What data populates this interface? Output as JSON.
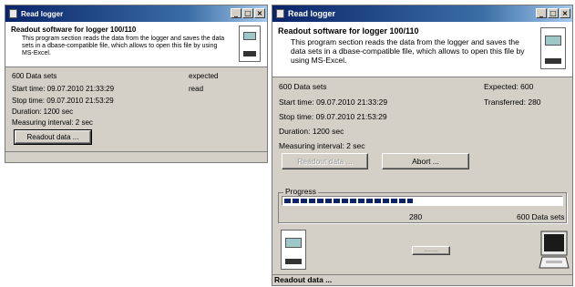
{
  "left_window": {
    "title": "Read logger",
    "header_title": "Readout software for logger 100/110",
    "header_desc": "This program section reads the data from the logger and saves the data sets in a dbase-compatible file, which allows to open this file by using MS-Excel.",
    "data_sets": "600 Data sets",
    "expected_label": "expected",
    "start_time": "Start time: 09.07.2010 21:33:29",
    "read_label": "read",
    "stop_time": "Stop time: 09.07.2010 21:53:29",
    "duration": "Duration: 1200 sec",
    "interval": "Measuring interval: 2 sec",
    "readout_button": "Readout data ..."
  },
  "right_window": {
    "title": "Read logger",
    "header_title": "Readout software for logger 100/110",
    "header_desc": "This program section reads the data from the logger and saves the data sets in a dbase-compatible file, which allows to open this file by using MS-Excel.",
    "data_sets": "600 Data sets",
    "expected": "Expected: 600",
    "start_time": "Start time: 09.07.2010 21:33:29",
    "transferred": "Transferred: 280",
    "stop_time": "Stop time: 09.07.2010 21:53:29",
    "duration": "Duration: 1200 sec",
    "interval": "Measuring interval: 2 sec",
    "readout_button": "Readout data ...",
    "abort_button": "Abort ...",
    "progress_label": "Progress",
    "progress_fraction": 0.4667,
    "progress_value": "280",
    "progress_total": "600 Data sets",
    "transfer_indicator": "........",
    "status_text": "Readout data ..."
  },
  "window_controls": {
    "minimize": "_",
    "maximize": "□",
    "close": "×"
  }
}
